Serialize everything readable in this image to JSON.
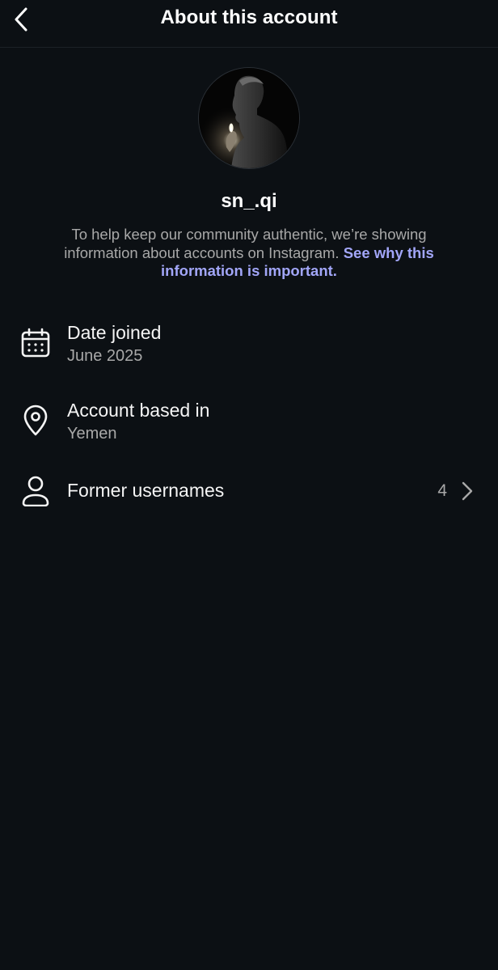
{
  "header": {
    "title": "About this account",
    "back_icon": "chevron-left-icon"
  },
  "profile": {
    "username": "sn_.qi",
    "avatar": "profile-photo-dark-portrait"
  },
  "notice": {
    "text": "To help keep our community authentic, we’re showing information about accounts on Instagram.",
    "link": "See why this information is important."
  },
  "rows": [
    {
      "icon": "calendar-icon",
      "title": "Date joined",
      "value": "June 2025"
    },
    {
      "icon": "location-pin-icon",
      "title": "Account based in",
      "value": "Yemen"
    },
    {
      "icon": "person-icon",
      "title": "Former usernames",
      "count": "4",
      "trailing_icon": "chevron-right-icon"
    }
  ],
  "colors": {
    "background": "#0c1014",
    "primary_text": "#f5f5f5",
    "secondary_text": "#a8a8a8",
    "link": "#a2a6f8"
  }
}
